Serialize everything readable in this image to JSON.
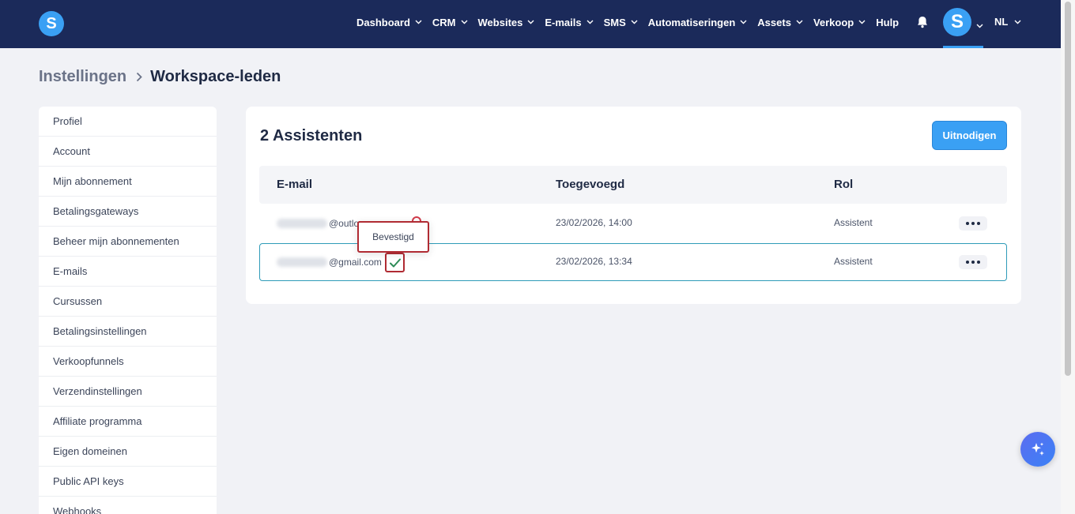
{
  "header": {
    "logo_letter": "S",
    "nav": [
      {
        "label": "Dashboard"
      },
      {
        "label": "CRM"
      },
      {
        "label": "Websites"
      },
      {
        "label": "E-mails"
      },
      {
        "label": "SMS"
      },
      {
        "label": "Automatiseringen"
      },
      {
        "label": "Assets"
      },
      {
        "label": "Verkoop"
      }
    ],
    "help_label": "Hulp",
    "avatar_letter": "S",
    "language": "NL"
  },
  "breadcrumb": {
    "parent": "Instellingen",
    "current": "Workspace-leden"
  },
  "sidebar": {
    "items": [
      {
        "label": "Profiel"
      },
      {
        "label": "Account"
      },
      {
        "label": "Mijn abonnement"
      },
      {
        "label": "Betalingsgateways"
      },
      {
        "label": "Beheer mijn abonnementen"
      },
      {
        "label": "E-mails"
      },
      {
        "label": "Cursussen"
      },
      {
        "label": "Betalingsinstellingen"
      },
      {
        "label": "Verkoopfunnels"
      },
      {
        "label": "Verzendinstellingen"
      },
      {
        "label": "Affiliate programma"
      },
      {
        "label": "Eigen domeinen"
      },
      {
        "label": "Public API keys"
      },
      {
        "label": "Webhooks"
      }
    ]
  },
  "members": {
    "title": "2 Assistenten",
    "invite_label": "Uitnodigen",
    "columns": {
      "email": "E-mail",
      "added": "Toegevoegd",
      "role": "Rol"
    },
    "rows": [
      {
        "email_domain": "@outlo",
        "added": "23/02/2026, 14:00",
        "role": "Assistent",
        "status": "pending"
      },
      {
        "email_domain": "@gmail.com",
        "added": "23/02/2026, 13:34",
        "role": "Assistent",
        "status": "confirmed"
      }
    ],
    "tooltip": "Bevestigd"
  },
  "colors": {
    "header_bg": "#1b2a5a",
    "accent": "#3aa0f4",
    "confirmed": "#2e8b57",
    "highlight": "#b02b33"
  }
}
